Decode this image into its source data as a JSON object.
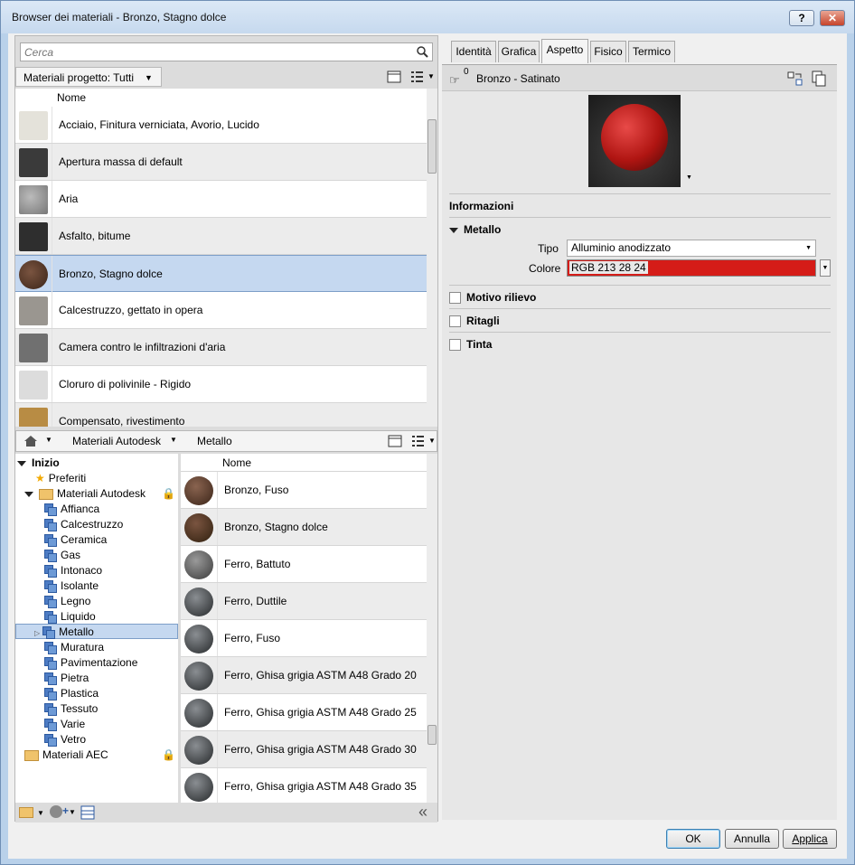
{
  "window": {
    "title": "Browser dei materiali - Bronzo, Stagno dolce",
    "help_label": "?",
    "close_label": "✕"
  },
  "search": {
    "placeholder": "Cerca"
  },
  "project": {
    "crumb": "Materiali progetto: Tutti",
    "header": "Nome",
    "items": [
      {
        "label": "Acciaio, Finitura verniciata, Avorio, Lucido",
        "color": "#e4e2da"
      },
      {
        "label": "Apertura massa di default",
        "color": "#3a3a3a"
      },
      {
        "label": "Aria",
        "color": "#8c8c8c"
      },
      {
        "label": "Asfalto, bitume",
        "color": "#2e2e2e"
      },
      {
        "label": "Bronzo, Stagno dolce",
        "color": "#5a3a28"
      },
      {
        "label": "Calcestruzzo, gettato in opera",
        "color": "#9a9690"
      },
      {
        "label": "Camera contro le infiltrazioni d'aria",
        "color": "#707070"
      },
      {
        "label": "Cloruro di polivinile - Rigido",
        "color": "#dcdcdc"
      },
      {
        "label": "Compensato, rivestimento",
        "color": "#b88c44"
      }
    ]
  },
  "library": {
    "crumbs": [
      "Materiali Autodesk",
      "Metallo"
    ],
    "tree": {
      "root": "Inizio",
      "favorites": "Preferiti",
      "autodesk": "Materiali Autodesk",
      "categories": [
        "Affianca",
        "Calcestruzzo",
        "Ceramica",
        "Gas",
        "Intonaco",
        "Isolante",
        "Legno",
        "Liquido",
        "Metallo",
        "Muratura",
        "Pavimentazione",
        "Pietra",
        "Plastica",
        "Tessuto",
        "Varie",
        "Vetro"
      ],
      "aec": "Materiali AEC"
    },
    "header": "Nome",
    "items": [
      {
        "label": "Bronzo, Fuso",
        "color": "#5a3c2c"
      },
      {
        "label": "Bronzo, Stagno dolce",
        "color": "#4e3426"
      },
      {
        "label": "Ferro, Battuto",
        "color": "#5e5e5e"
      },
      {
        "label": "Ferro, Duttile",
        "color": "#3e4246"
      },
      {
        "label": "Ferro, Fuso",
        "color": "#3e4246"
      },
      {
        "label": "Ferro, Ghisa grigia ASTM A48 Grado 20",
        "color": "#3e4246"
      },
      {
        "label": "Ferro, Ghisa grigia ASTM A48 Grado 25",
        "color": "#3e4246"
      },
      {
        "label": "Ferro, Ghisa grigia ASTM A48 Grado 30",
        "color": "#3e4246"
      },
      {
        "label": "Ferro, Ghisa grigia ASTM A48 Grado 35",
        "color": "#3e4246"
      }
    ],
    "collapse": "«"
  },
  "editor": {
    "tabs": [
      "Identità",
      "Grafica",
      "Aspetto",
      "Fisico",
      "Termico"
    ],
    "asset_count": "0",
    "asset_name": "Bronzo - Satinato",
    "sections": {
      "info": "Informazioni",
      "metal": "Metallo",
      "relief": "Motivo rilievo",
      "cutouts": "Ritagli",
      "tint": "Tinta"
    },
    "type_label": "Tipo",
    "type_value": "Alluminio anodizzato",
    "color_label": "Colore",
    "color_value": "RGB 213 28 24",
    "color_hex": "#d51c18"
  },
  "buttons": {
    "ok": "OK",
    "cancel": "Annulla",
    "apply": "Applica"
  }
}
